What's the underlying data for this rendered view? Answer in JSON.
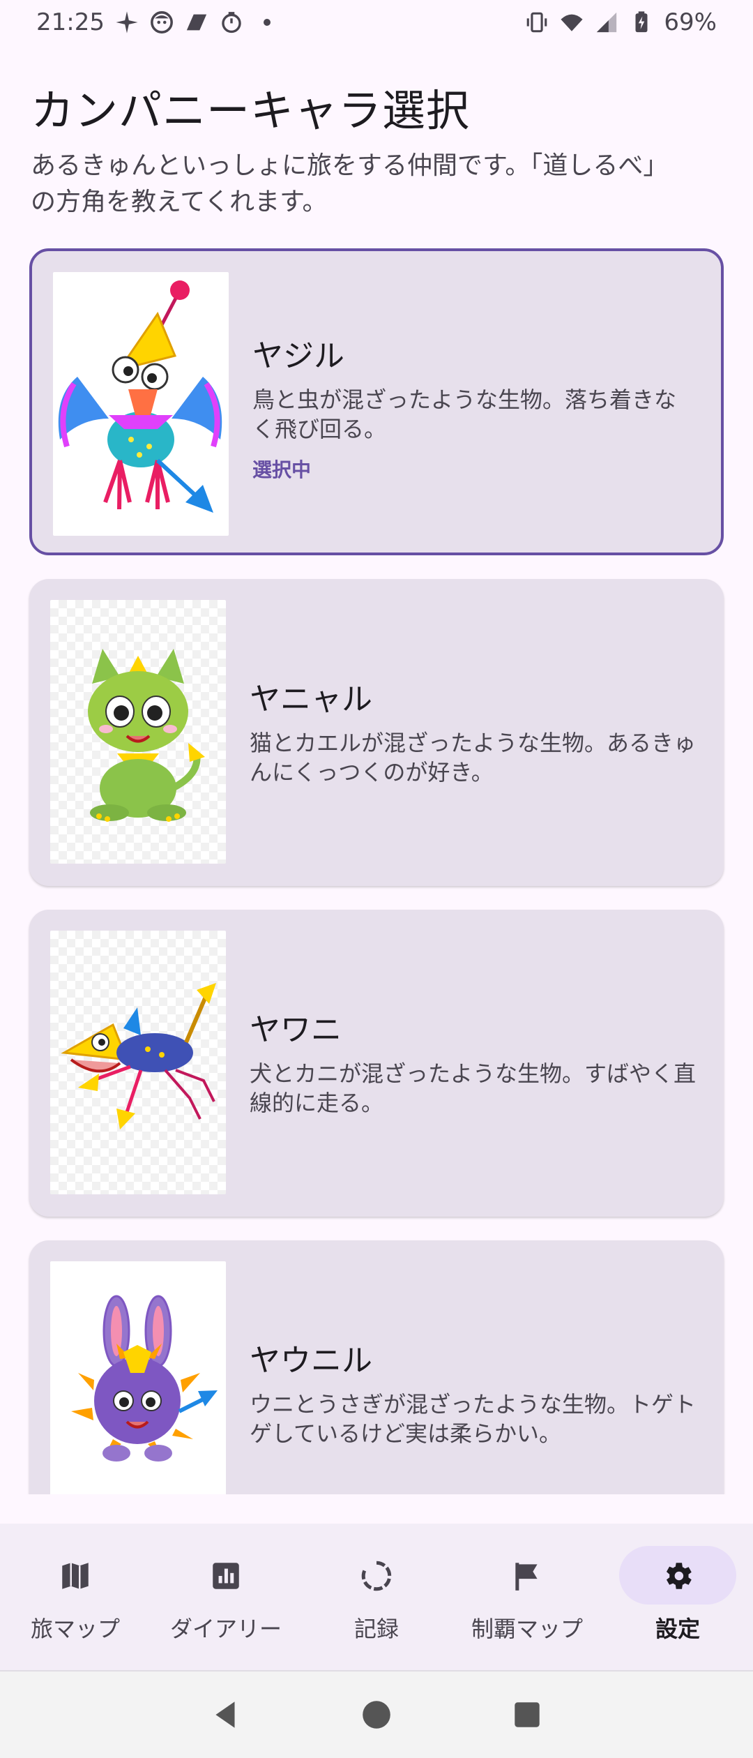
{
  "status_bar": {
    "time": "21:25",
    "battery": "69%",
    "left_icons": [
      "sparkle-icon",
      "face-icon",
      "parallelogram-icon",
      "timer-icon"
    ],
    "right_icons": [
      "vibrate-icon",
      "wifi-icon",
      "signal-icon",
      "battery-icon"
    ]
  },
  "header": {
    "title": "カンパニーキャラ選択",
    "subtitle_line1": "あるきゅんといっしょに旅をする仲間です。「道しるべ」",
    "subtitle_line2": "の方角を教えてくれます。"
  },
  "characters": [
    {
      "name": "ヤジル",
      "description": "鳥と虫が混ざったような生物。落ち着きなく飛び回る。",
      "status": "選択中",
      "selected": true,
      "icon": "bird-arrow-creature"
    },
    {
      "name": "ヤニャル",
      "description": "猫とカエルが混ざったような生物。あるきゅんにくっつくのが好き。",
      "status": "",
      "selected": false,
      "icon": "cat-frog-creature"
    },
    {
      "name": "ヤワニ",
      "description": "犬とカニが混ざったような生物。すばやく直線的に走る。",
      "status": "",
      "selected": false,
      "icon": "dog-crab-creature"
    },
    {
      "name": "ヤウニル",
      "description": "ウニとうさぎが混ざったような生物。トゲトゲしているけど実は柔らかい。",
      "status": "",
      "selected": false,
      "icon": "urchin-rabbit-creature"
    }
  ],
  "bottom_nav": {
    "items": [
      {
        "label": "旅マップ",
        "icon": "map-icon",
        "active": false
      },
      {
        "label": "ダイアリー",
        "icon": "chart-icon",
        "active": false
      },
      {
        "label": "記録",
        "icon": "progress-icon",
        "active": false
      },
      {
        "label": "制覇マップ",
        "icon": "flag-icon",
        "active": false
      },
      {
        "label": "設定",
        "icon": "gear-icon",
        "active": true
      }
    ]
  },
  "colors": {
    "primary": "#6750a4",
    "card_bg": "#e7e0ec",
    "background": "#fef7ff",
    "nav_bg": "#f3edf7",
    "active_indicator": "#e8def8"
  }
}
